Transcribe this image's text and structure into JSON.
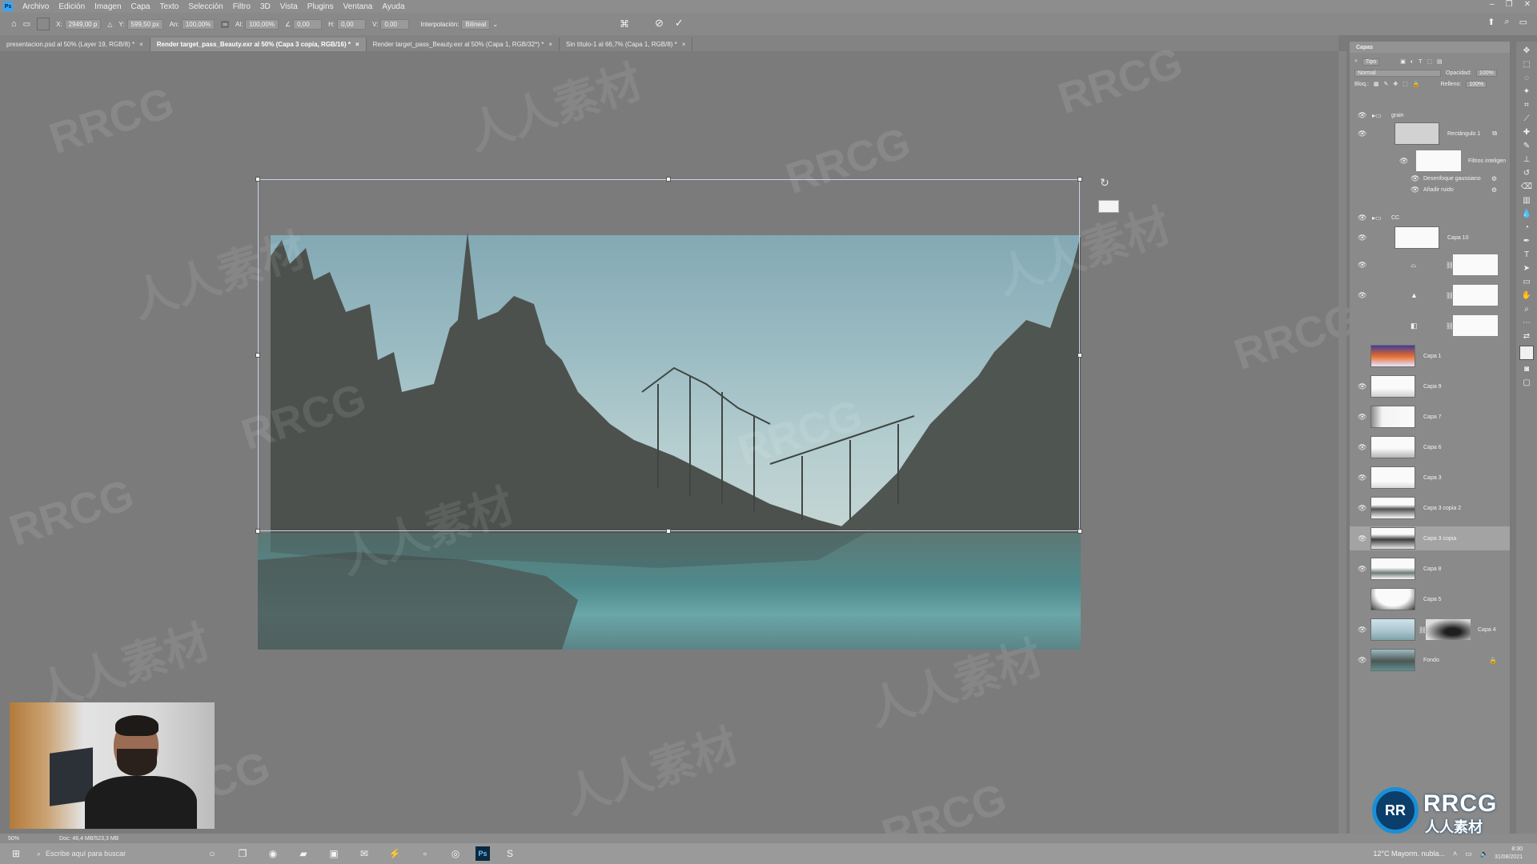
{
  "app": {
    "logo_label": "Ps",
    "menu": [
      "Archivo",
      "Edición",
      "Imagen",
      "Capa",
      "Texto",
      "Selección",
      "Filtro",
      "3D",
      "Vista",
      "Plugins",
      "Ventana",
      "Ayuda"
    ]
  },
  "options": {
    "x_label": "X:",
    "x_value": "2949,00 p",
    "y_label": "Y:",
    "y_value": "599,50 px",
    "w_label": "An:",
    "w_value": "100,00%",
    "h_label": "Al:",
    "h_value": "100,00%",
    "angle_label": "∠",
    "angle_value": "0,00",
    "hskew_label": "H:",
    "hskew_value": "0,00",
    "vskew_label": "V:",
    "vskew_value": "0,00",
    "interp_label": "Interpolación:",
    "interp_value": "Bilineal"
  },
  "tabs": [
    {
      "label": "presentacion.psd al 50% (Layer 19, RGB/8) *"
    },
    {
      "label": "Render target_pass_Beauty.exr al 50% (Capa 3 copia, RGB/16) *"
    },
    {
      "label": "Render target_pass_Beauty.exr al 50% (Capa 1, RGB/32*) *"
    },
    {
      "label": "Sin título-1 al 66,7% (Capa 1, RGB/8) *"
    }
  ],
  "layers_panel": {
    "title": "Capas",
    "filter_value": "Tipo",
    "blend_mode": "Normal",
    "opacity_label": "Opacidad:",
    "opacity_value": "100%",
    "lock_label": "Bloq.:",
    "fill_label": "Relleno:",
    "fill_value": "100%",
    "layers": [
      {
        "name": "grain"
      },
      {
        "name": "Rectángulo 1"
      },
      {
        "name": "Filtros inteligen"
      },
      {
        "name": "Desenfoque gaussiano"
      },
      {
        "name": "Añadir ruido"
      },
      {
        "name": "CC"
      },
      {
        "name": "Capa 10"
      },
      {
        "name": "Capa 1"
      },
      {
        "name": "Capa 9"
      },
      {
        "name": "Capa 7"
      },
      {
        "name": "Capa 6"
      },
      {
        "name": "Capa 3"
      },
      {
        "name": "Capa 3 copia 2"
      },
      {
        "name": "Capa 3 copia"
      },
      {
        "name": "Capa 8"
      },
      {
        "name": "Capa 5"
      },
      {
        "name": "Capa 4"
      },
      {
        "name": "Fondo"
      }
    ]
  },
  "status": {
    "zoom": "50%",
    "doc": "Doc: 46,4 MB/523,3 MB"
  },
  "taskbar": {
    "search_placeholder": "Escribe aquí para buscar",
    "weather": "12°C  Mayorm. nubla...",
    "time": "8:30",
    "date": "31/08/2021"
  },
  "watermark": {
    "latin": "RRCG",
    "cn": "人人素材",
    "logo_mark": "RR"
  }
}
